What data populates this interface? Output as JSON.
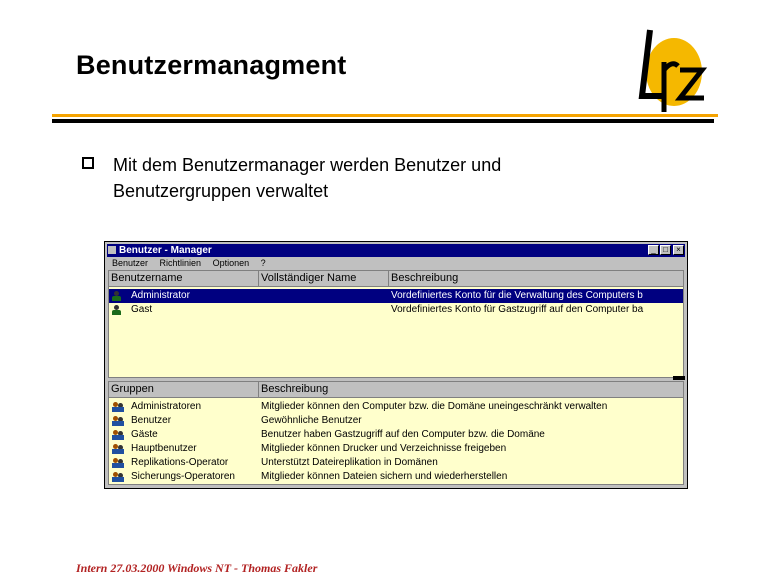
{
  "slide": {
    "title": "Benutzermanagment",
    "bullet": "Mit dem Benutzermanager werden Benutzer und Benutzergruppen verwaltet",
    "footer": "Intern 27.03.2000 Windows NT - Thomas Fakler",
    "logo_text": "Lrz",
    "colors": {
      "accent": "#f5a300",
      "rule": "#000000",
      "footer": "#b22222"
    }
  },
  "window": {
    "title": "Benutzer - Manager",
    "controls": [
      "_",
      "□",
      "×"
    ],
    "menu": [
      "Benutzer",
      "Richtlinien",
      "Optionen",
      "?"
    ],
    "users_headers": [
      "Benutzername",
      "Vollständiger Name",
      "Beschreibung"
    ],
    "users": [
      {
        "name": "Administrator",
        "fullname": "",
        "desc": "Vordefiniertes Konto für die Verwaltung des Computers b",
        "selected": true
      },
      {
        "name": "Gast",
        "fullname": "",
        "desc": "Vordefiniertes Konto für Gastzugriff auf den Computer ba",
        "selected": false
      }
    ],
    "groups_headers": [
      "Gruppen",
      "Beschreibung"
    ],
    "groups": [
      {
        "name": "Administratoren",
        "desc": "Mitglieder können den Computer bzw. die Domäne uneingeschränkt verwalten"
      },
      {
        "name": "Benutzer",
        "desc": "Gewöhnliche Benutzer"
      },
      {
        "name": "Gäste",
        "desc": "Benutzer haben Gastzugriff auf den Computer bzw. die Domäne"
      },
      {
        "name": "Hauptbenutzer",
        "desc": "Mitglieder können Drucker und Verzeichnisse freigeben"
      },
      {
        "name": "Replikations-Operator",
        "desc": "Unterstützt Dateireplikation in Domänen"
      },
      {
        "name": "Sicherungs-Operatoren",
        "desc": "Mitglieder können Dateien sichern und wiederherstellen"
      }
    ],
    "icons": {
      "user": "user-icon",
      "group": "group-icon"
    }
  }
}
